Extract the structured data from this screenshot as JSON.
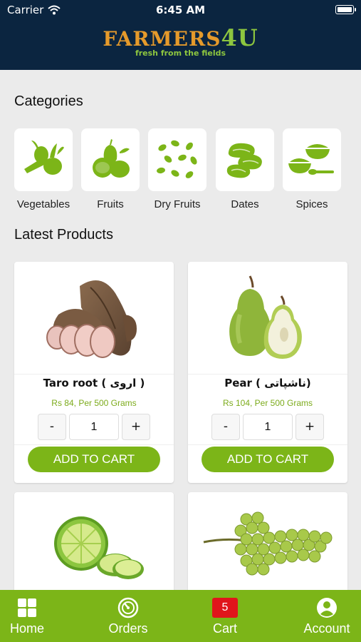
{
  "status_bar": {
    "carrier": "Carrier",
    "time": "6:45 AM"
  },
  "header": {
    "brand_main": "FARMERS",
    "brand_accent": "4U",
    "tagline": "fresh from the fields"
  },
  "categories": {
    "title": "Categories",
    "items": [
      {
        "label": "Vegetables",
        "icon": "vegetables-icon"
      },
      {
        "label": "Fruits",
        "icon": "fruits-icon"
      },
      {
        "label": "Dry Fruits",
        "icon": "dry-fruits-icon"
      },
      {
        "label": "Dates",
        "icon": "dates-icon"
      },
      {
        "label": "Spices",
        "icon": "spices-icon"
      }
    ]
  },
  "products": {
    "title": "Latest Products",
    "items": [
      {
        "name": "Taro root ( اروی )",
        "price": "Rs 84, Per 500 Grams",
        "qty": "1",
        "minus": "-",
        "plus": "+",
        "add_label": "ADD TO CART",
        "image": "taro-root-image"
      },
      {
        "name": "Pear ( ناشپاتی)",
        "price": "Rs 104, Per 500 Grams",
        "qty": "1",
        "minus": "-",
        "plus": "+",
        "add_label": "ADD TO CART",
        "image": "pear-image"
      },
      {
        "image": "lime-image"
      },
      {
        "image": "grapes-image"
      }
    ]
  },
  "tabbar": {
    "items": [
      {
        "label": "Home",
        "icon": "home-icon"
      },
      {
        "label": "Orders",
        "icon": "orders-icon"
      },
      {
        "label": "Cart",
        "icon": "cart-badge",
        "badge": "5"
      },
      {
        "label": "Account",
        "icon": "account-icon"
      }
    ]
  },
  "colors": {
    "header_bg": "#0b2540",
    "brand_orange": "#e59a2b",
    "accent_green": "#7cb518",
    "price_green": "#7cab1b",
    "badge_red": "#e0151b"
  }
}
